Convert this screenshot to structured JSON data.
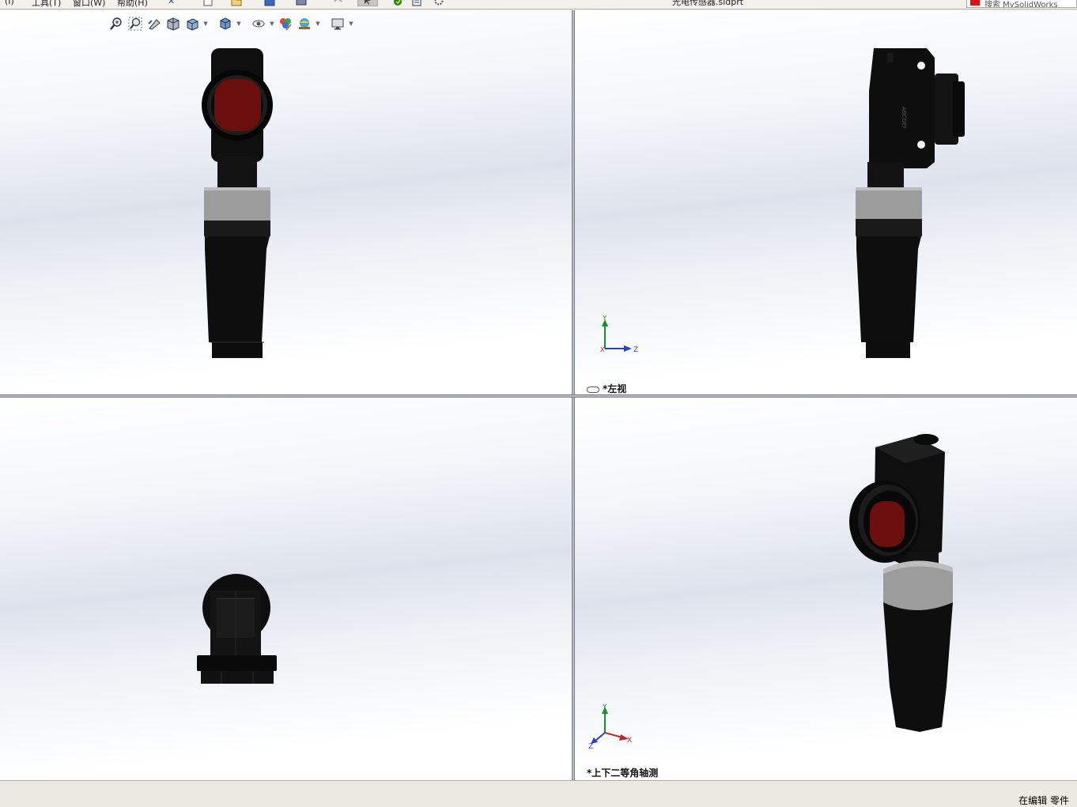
{
  "menu": {
    "items": [
      "工具(T)",
      "窗口(W)",
      "帮助(H)"
    ],
    "pin_glyph": "✕"
  },
  "window": {
    "title": "光电传感器.sldprt"
  },
  "search": {
    "placeholder": "搜索 MySolidWorks"
  },
  "hud_toolbar": {
    "icons": [
      "zoom-to-fit-icon",
      "zoom-to-area-icon",
      "previous-view-icon",
      "section-view-icon",
      "view-orientation-icon",
      "display-style-icon",
      "hide-show-items-icon",
      "edit-appearance-icon",
      "apply-scene-icon",
      "view-settings-icon"
    ]
  },
  "viewports": {
    "top_right": {
      "label": "*左视"
    },
    "bottom_right": {
      "label": "*上下二等角轴测"
    }
  },
  "triad": {
    "y": "Y",
    "z": "Z",
    "x": "X"
  },
  "status": {
    "text": "在编辑 零件"
  },
  "colors": {
    "lens": "#6b0e0e",
    "body": "#0d0d0d",
    "ring": "#9c9c9c",
    "viewport_top": "#ffffff",
    "viewport_mid": "#dde2ec"
  }
}
